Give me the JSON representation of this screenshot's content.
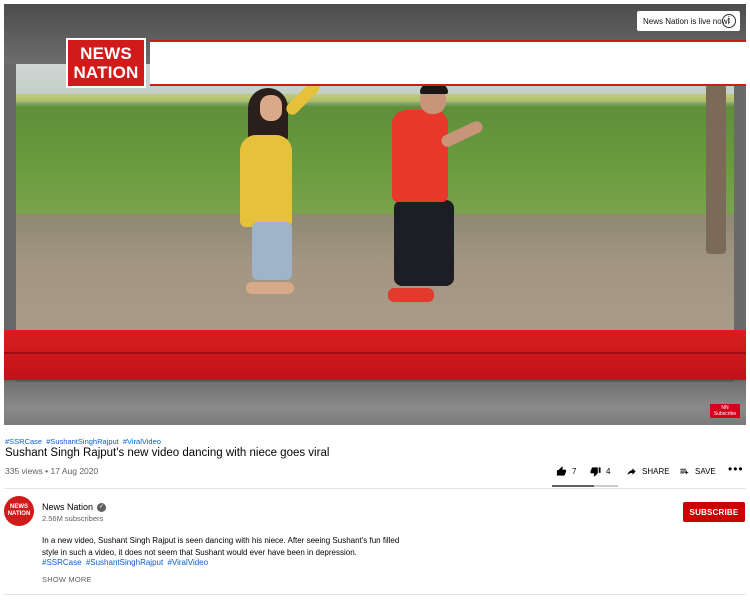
{
  "player": {
    "live_notice": "News Nation is live now!",
    "info_glyph": "i",
    "logo_line1": "NEWS",
    "logo_line2": "NATION",
    "corner_badge_line1": "NN",
    "corner_badge_line2": "Subscribe"
  },
  "video": {
    "hashtags": [
      "#SSRCase",
      "#SushantSinghRajput",
      "#ViralVideo"
    ],
    "title": "Sushant Singh Rajput's new video dancing with niece goes viral",
    "views_date": "335 views • 17 Aug 2020",
    "like_count": "7",
    "dislike_count": "4",
    "like_ratio": 0.636,
    "share_label": "SHARE",
    "save_label": "SAVE",
    "more_label": "•••"
  },
  "channel": {
    "avatar_line1": "NEWS",
    "avatar_line2": "NATION",
    "name": "News Nation",
    "verified_glyph": "✓",
    "subscribers": "2.56M subscribers",
    "subscribe_label": "SUBSCRIBE"
  },
  "description": {
    "text": "In a new video, Sushant Singh Rajput is seen dancing with his niece. After seeing Sushant's fun filled style in such a video, it does not seem that Sushant would ever have been in depression.",
    "hashtags": [
      "#SSRCase",
      "#SushantSinghRajput",
      "#ViralVideo"
    ],
    "show_more": "SHOW MORE"
  },
  "colors": {
    "brand_red": "#cc0000",
    "link_blue": "#065fd4",
    "secondary_text": "#606060"
  }
}
